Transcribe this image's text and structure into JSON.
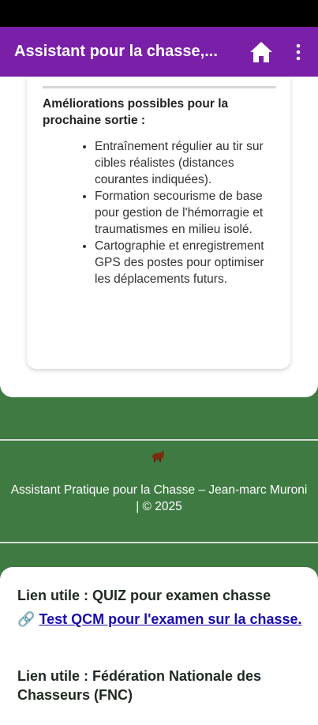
{
  "app_bar": {
    "title": "Assistant pour la chasse,...",
    "home_icon": "home-icon",
    "more_icon": "more-vertical-icon",
    "background": "#7a1fa8"
  },
  "card": {
    "section_title": "Améliorations possibles pour la prochaine sortie :",
    "bullets": [
      "Entraînement régulier au tir sur cibles réalistes (distances courantes indiquées).",
      "Formation secourisme de base pour gestion de l'hémorragie et traumatismes en milieu isolé.",
      "Cartographie et enregistrement GPS des postes pour optimiser les déplacements futurs."
    ]
  },
  "footer": {
    "icon": "boar-icon",
    "text": "Assistant Pratique pour la Chasse – Jean-marc Muroni | © 2025",
    "background": "#3f7a43"
  },
  "links": {
    "quiz_heading": "Lien utile : QUIZ pour examen chasse",
    "quiz_link_emoji": "🔗",
    "quiz_link_text": "Test QCM pour l'examen sur la chasse.",
    "fnc_heading": "Lien utile : Fédération Nationale des Chasseurs (FNC)"
  }
}
